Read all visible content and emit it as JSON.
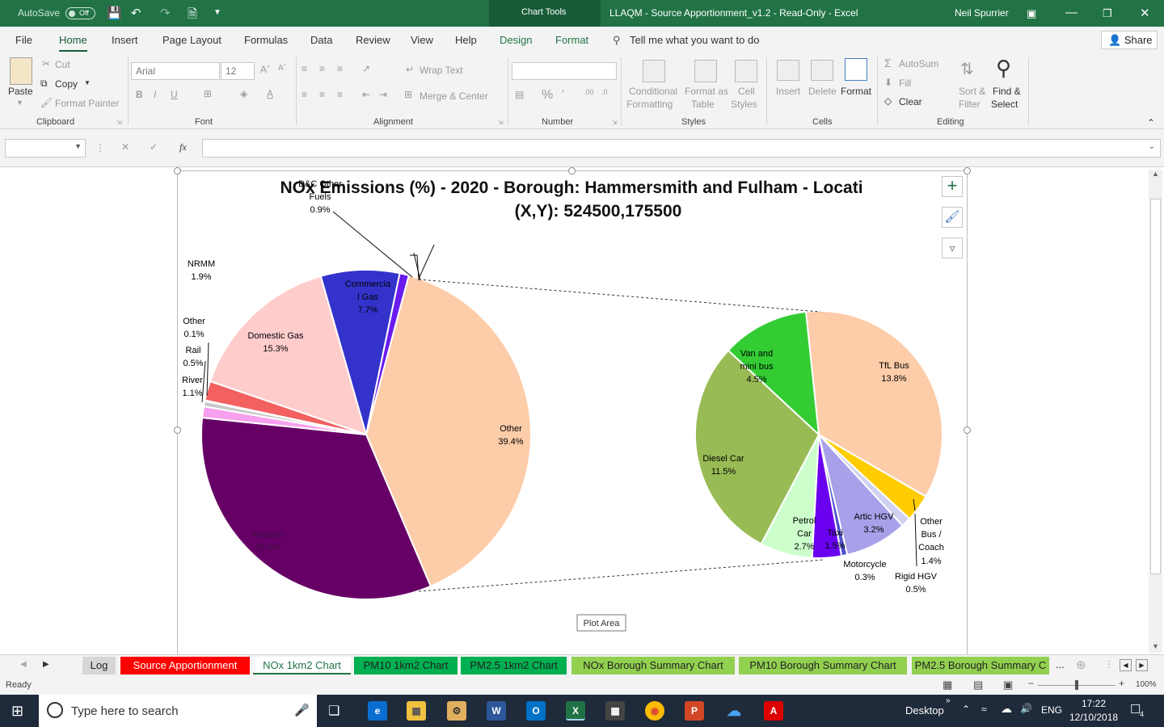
{
  "titlebar": {
    "autosave_label": "AutoSave",
    "autosave_state": "Off",
    "chart_tools": "Chart Tools",
    "doc_title": "LLAQM - Source Apportionment_v1.2  -  Read-Only  -  Excel",
    "user": "Neil Spurrier"
  },
  "menu": {
    "file": "File",
    "home": "Home",
    "insert": "Insert",
    "page_layout": "Page Layout",
    "formulas": "Formulas",
    "data": "Data",
    "review": "Review",
    "view": "View",
    "help": "Help",
    "design": "Design",
    "format": "Format",
    "tell_me": "Tell me what you want to do",
    "share": "Share"
  },
  "ribbon": {
    "clipboard": {
      "paste": "Paste",
      "cut": "Cut",
      "copy": "Copy",
      "format_painter": "Format Painter",
      "group": "Clipboard"
    },
    "font": {
      "name": "Arial",
      "size": "12",
      "group": "Font"
    },
    "alignment": {
      "wrap_text": "Wrap Text",
      "merge_center": "Merge & Center",
      "group": "Alignment"
    },
    "number": {
      "group": "Number"
    },
    "styles": {
      "conditional_1": "Conditional",
      "conditional_2": "Formatting",
      "format_table_1": "Format as",
      "format_table_2": "Table",
      "cell_styles_1": "Cell",
      "cell_styles_2": "Styles",
      "group": "Styles"
    },
    "cells": {
      "insert": "Insert",
      "delete": "Delete",
      "format": "Format",
      "group": "Cells"
    },
    "editing": {
      "autosum": "AutoSum",
      "fill": "Fill",
      "clear": "Clear",
      "sort_1": "Sort &",
      "sort_2": "Filter",
      "find_1": "Find &",
      "find_2": "Select",
      "group": "Editing"
    }
  },
  "formula_bar": {
    "fx": "fx"
  },
  "chart_data": {
    "type": "pie",
    "title": "NOx Emissions (%) - 2020 - Borough: Hammersmith and Fulham - Locati",
    "subtitle": "(X,Y): 524500,175500",
    "main_pie": [
      {
        "label": "Other",
        "value": 39.4,
        "color": "#fdcca9"
      },
      {
        "label": "Aviation",
        "value": 33.0,
        "color": "#660066"
      },
      {
        "label": "River",
        "value": 1.1,
        "color": "#f8a0f0"
      },
      {
        "label": "Rail",
        "value": 0.5,
        "color": "#c8c8c8"
      },
      {
        "label": "Other",
        "value": 0.1,
        "color": "#8c8c8c"
      },
      {
        "label": "NRMM",
        "value": 1.9,
        "color": "#f26060"
      },
      {
        "label": "Domestic Gas",
        "value": 15.3,
        "color": "#ffcccc"
      },
      {
        "label": "Commercial Gas",
        "value": 7.7,
        "color": "#3333cc"
      },
      {
        "label": "D&C Other Fuels",
        "value": 0.9,
        "color": "#6a1bf0"
      }
    ],
    "secondary_pie": [
      {
        "label": "TfL Bus",
        "value": 13.8,
        "color": "#fdcca9"
      },
      {
        "label": "Other Bus / Coach",
        "value": 1.4,
        "color": "#ffcc00"
      },
      {
        "label": "Rigid HGV",
        "value": 0.5,
        "color": "#d0d0f0"
      },
      {
        "label": "Artic HGV",
        "value": 3.2,
        "color": "#a8a0e8"
      },
      {
        "label": "Motorcycle",
        "value": 0.3,
        "color": "#5050d0"
      },
      {
        "label": "Taxi",
        "value": 1.5,
        "color": "#6a00f0"
      },
      {
        "label": "Petrol Car",
        "value": 2.7,
        "color": "#ccffcc"
      },
      {
        "label": "Diesel Car",
        "value": 11.5,
        "color": "#99bb55"
      },
      {
        "label": "Van and mini bus",
        "value": 4.5,
        "color": "#33cc33"
      }
    ],
    "labels": {
      "dc_1": "D&C Other",
      "dc_2": "Fuels",
      "dc_pct": "0.9%",
      "nrmm": "NRMM",
      "nrmm_pct": "1.9%",
      "other_small": "Other",
      "other_small_pct": "0.1%",
      "rail": "Rail",
      "rail_pct": "0.5%",
      "river": "River",
      "river_pct": "1.1%",
      "commercial_1": "Commercia",
      "commercial_2": "l Gas",
      "commercial_pct": "7.7%",
      "domestic": "Domestic Gas",
      "domestic_pct": "15.3%",
      "other_main": "Other",
      "other_main_pct": "39.4%",
      "aviation": "Aviation",
      "aviation_pct": "33.0%",
      "van_1": "Van and",
      "van_2": "mini bus",
      "van_pct": "4.5%",
      "tfl": "TfL Bus",
      "tfl_pct": "13.8%",
      "diesel": "Diesel Car",
      "diesel_pct": "11.5%",
      "petrol_1": "Petrol",
      "petrol_2": "Car",
      "petrol_pct": "2.7%",
      "taxi": "Taxi",
      "taxi_pct": "1.5%",
      "artic": "Artic HGV",
      "artic_pct": "3.2%",
      "otherbus_1": "Other",
      "otherbus_2": "Bus /",
      "otherbus_3": "Coach",
      "otherbus_pct": "1.4%",
      "moto": "Motorcycle",
      "moto_pct": "0.3%",
      "rigid": "Rigid HGV",
      "rigid_pct": "0.5%"
    },
    "tooltip": "Plot Area"
  },
  "sheets": [
    {
      "name": "Log",
      "color": "#d6d6d6",
      "text": "#222"
    },
    {
      "name": "Source Apportionment",
      "color": "#ff0000",
      "text": "#fff"
    },
    {
      "name": "NOx 1km2 Chart",
      "color": "#ffffff",
      "text": "#217346"
    },
    {
      "name": "PM10 1km2 Chart",
      "color": "#00b050",
      "text": "#222"
    },
    {
      "name": "PM2.5 1km2 Chart",
      "color": "#00b050",
      "text": "#222"
    },
    {
      "name": "NOx Borough Summary Chart",
      "color": "#92d050",
      "text": "#222"
    },
    {
      "name": "PM10 Borough Summary Chart",
      "color": "#92d050",
      "text": "#222"
    },
    {
      "name": "PM2.5 Borough Summary C",
      "color": "#92d050",
      "text": "#222"
    }
  ],
  "sheet_more": "...",
  "status": {
    "ready": "Ready",
    "zoom": "100%"
  },
  "taskbar": {
    "search": "Type here to search",
    "desktop": "Desktop",
    "lang": "ENG",
    "time": "17:22",
    "date": "12/10/2018",
    "notif": "4"
  }
}
